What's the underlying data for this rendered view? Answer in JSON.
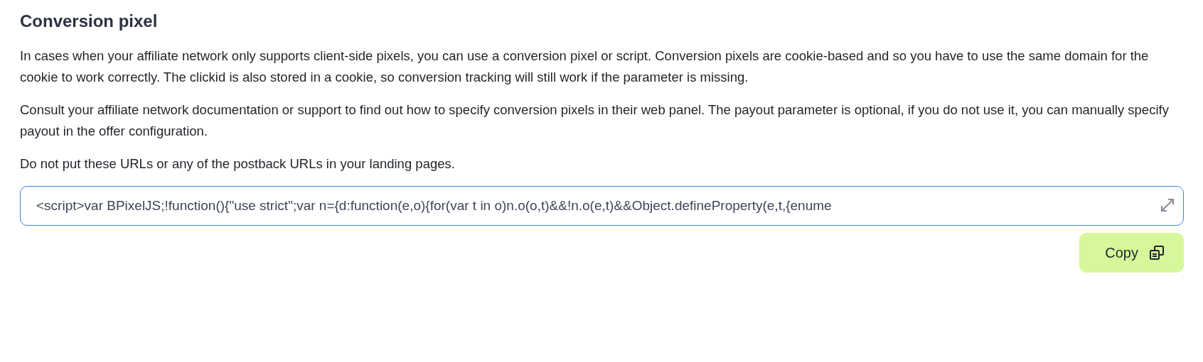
{
  "title": "Conversion pixel",
  "paragraphs": [
    "In cases when your affiliate network only supports client-side pixels, you can use a conversion pixel or script. Conversion pixels are cookie-based and so you have to use the same domain for the cookie to work correctly. The clickid is also stored in a cookie, so conversion tracking will still work if the parameter is missing.",
    "Consult your affiliate network documentation or support to find out how to specify conversion pixels in their web panel. The payout parameter is optional, if you do not use it, you can manually specify payout in the offer configuration.",
    "Do not put these URLs or any of the postback URLs in your landing pages."
  ],
  "code_field": {
    "value": "<script>var BPixelJS;!function(){\"use strict\";var n={d:function(e,o){for(var t in o)n.o(o,t)&&!n.o(e,t)&&Object.defineProperty(e,t,{enume"
  },
  "copy_button": {
    "label": "Copy"
  }
}
